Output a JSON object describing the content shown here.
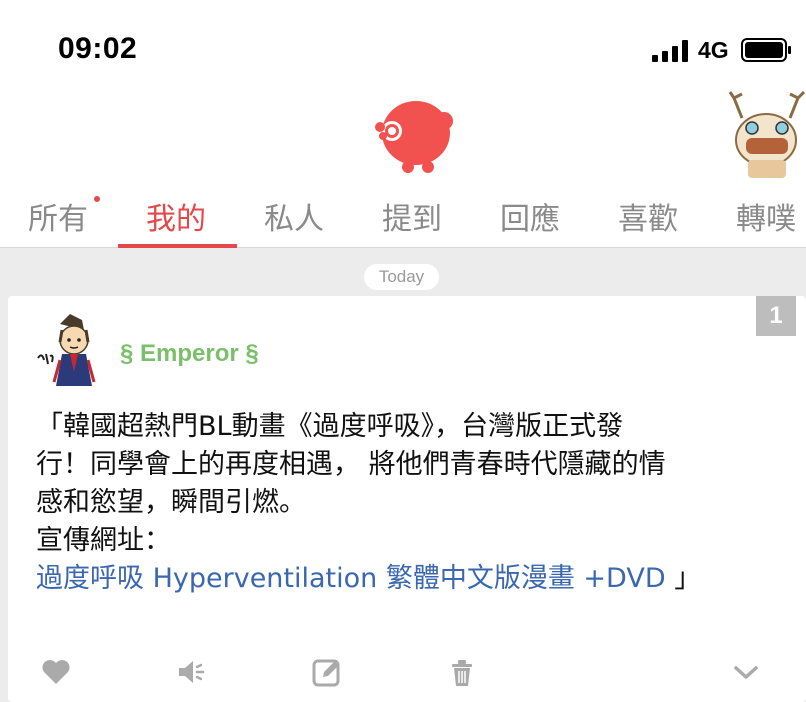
{
  "status_bar": {
    "time": "09:02",
    "network": "4G"
  },
  "tabs": [
    {
      "label": "所有",
      "has_dot": true
    },
    {
      "label": "我的",
      "active": true
    },
    {
      "label": "私人"
    },
    {
      "label": "提到"
    },
    {
      "label": "回應"
    },
    {
      "label": "喜歡"
    },
    {
      "label": "轉噗"
    }
  ],
  "date_pill": "Today",
  "post": {
    "response_count": "1",
    "author": "§ Emperor §",
    "text_line1": "「韓國超熱門BL動畫《過度呼吸》，台灣版正式發",
    "text_line2": "行！同學會上的再度相遇， 將他們青春時代隱藏的情",
    "text_line3": "感和慾望，瞬間引燃。",
    "text_line4": "宣傳網址：",
    "link_text": "過度呼吸 Hyperventilation 繁體中文版漫畫 +DVD",
    "text_end": "」"
  },
  "colors": {
    "accent": "#e4484a",
    "author": "#7ac06a",
    "link": "#3a67b0",
    "icon": "#aaaaaa"
  },
  "icons": [
    "heart-icon",
    "mute-icon",
    "edit-icon",
    "trash-icon",
    "chevron-down-icon"
  ]
}
